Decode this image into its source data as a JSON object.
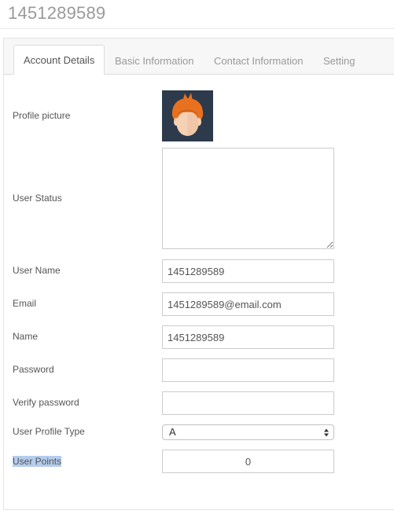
{
  "page": {
    "title": "1451289589"
  },
  "tabs": [
    {
      "label": "Account Details",
      "active": true
    },
    {
      "label": "Basic Information",
      "active": false
    },
    {
      "label": "Contact Information",
      "active": false
    },
    {
      "label": "Setting",
      "active": false
    }
  ],
  "form": {
    "profile_picture_label": "Profile picture",
    "user_status_label": "User Status",
    "user_status_value": "",
    "username_label": "User Name",
    "username_value": "1451289589",
    "email_label": "Email",
    "email_value": "1451289589@email.com",
    "name_label": "Name",
    "name_value": "1451289589",
    "password_label": "Password",
    "password_value": "",
    "verify_password_label": "Verify password",
    "verify_password_value": "",
    "profile_type_label": "User Profile Type",
    "profile_type_value": "A",
    "points_label": "User Points",
    "points_value": "0"
  },
  "colors": {
    "avatar_background": "#2d3a4c",
    "avatar_hair": "#e8711f",
    "avatar_skin": "#f7d1b3",
    "text_selection": "#b4cdee"
  },
  "icons": {
    "profile_picture": "cartoon-avatar",
    "select_arrows": "up-down-arrows"
  }
}
